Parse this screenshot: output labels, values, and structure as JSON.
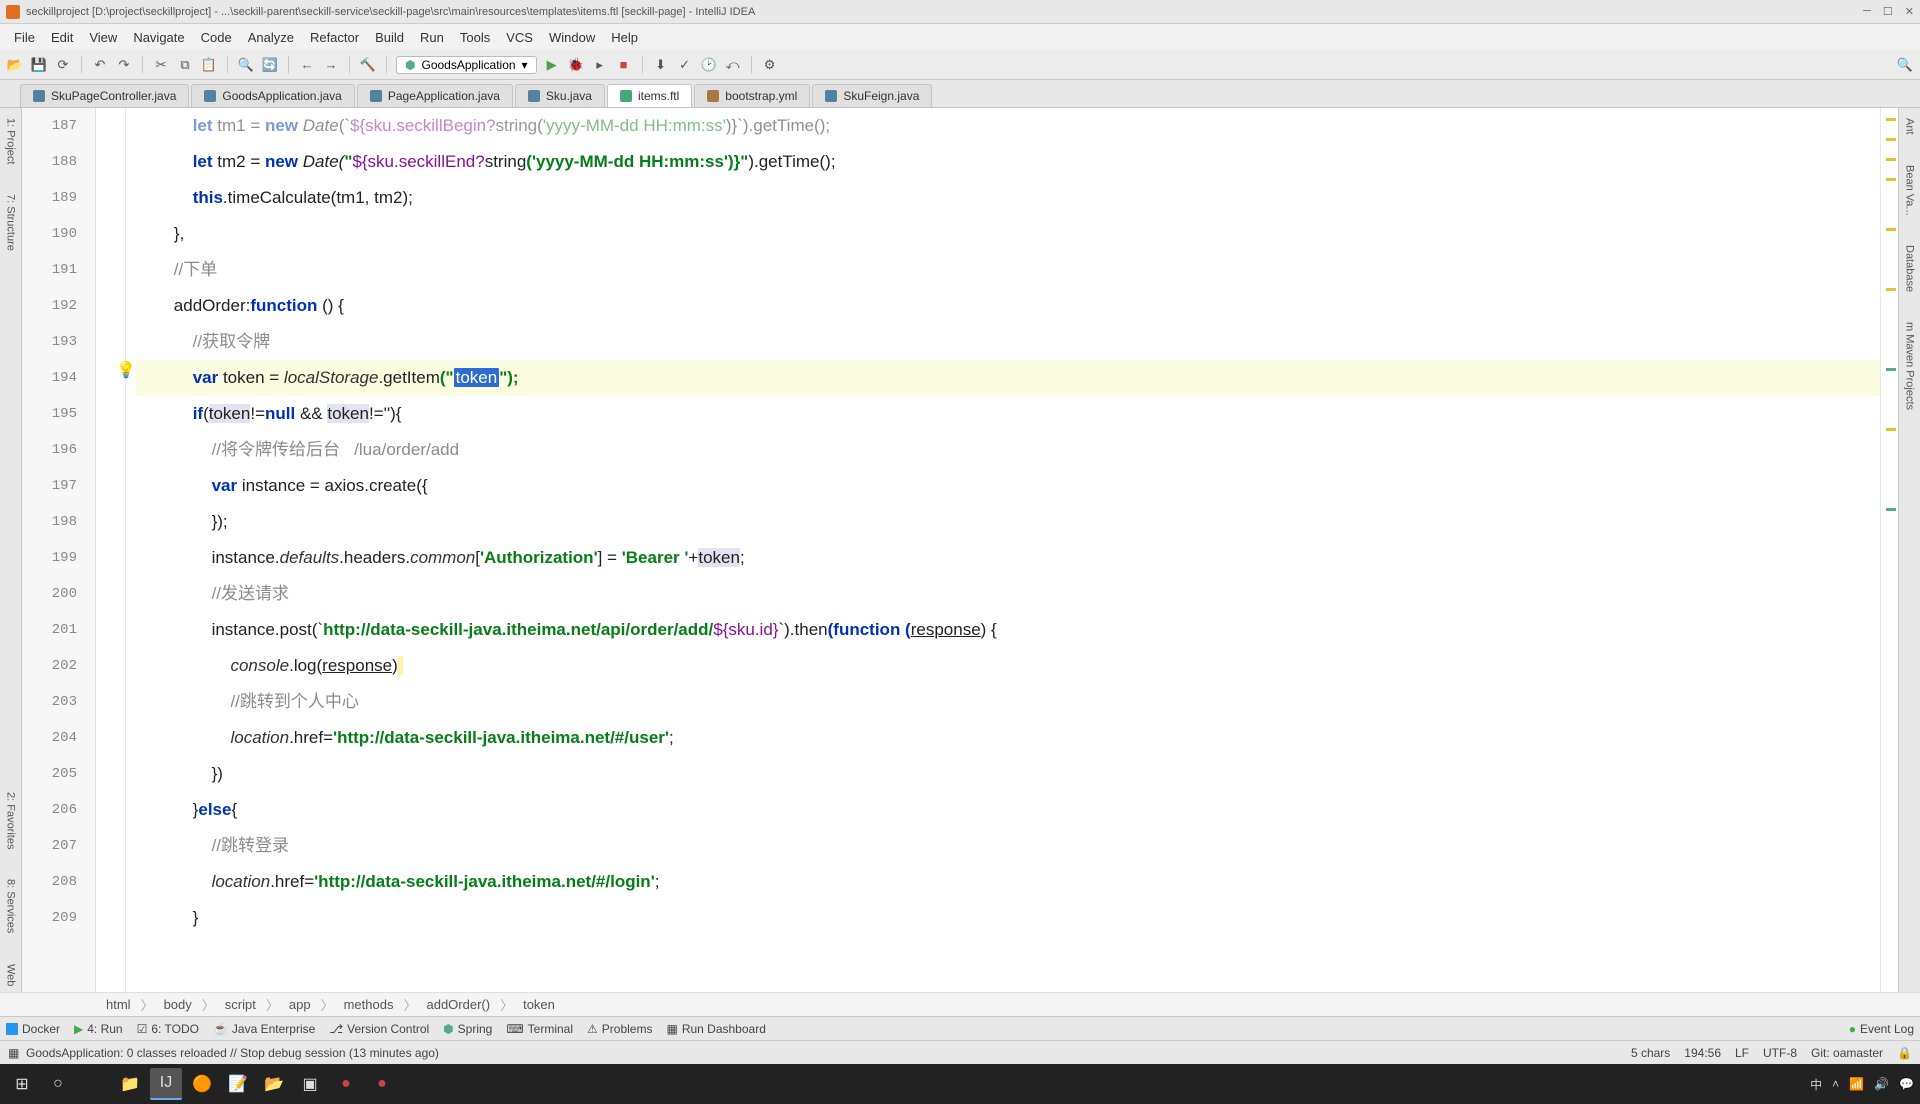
{
  "titlebar": {
    "text": "seckillproject [D:\\project\\seckillproject] - ...\\seckill-parent\\seckill-service\\seckill-page\\src\\main\\resources\\templates\\items.ftl [seckill-page] - IntelliJ IDEA"
  },
  "menu": [
    "File",
    "Edit",
    "View",
    "Navigate",
    "Code",
    "Analyze",
    "Refactor",
    "Build",
    "Run",
    "Tools",
    "VCS",
    "Window",
    "Help"
  ],
  "run_config": {
    "label": "GoodsApplication"
  },
  "tabs": [
    {
      "label": "SkuPageController.java",
      "type": "java",
      "active": false
    },
    {
      "label": "GoodsApplication.java",
      "type": "java",
      "active": false
    },
    {
      "label": "PageApplication.java",
      "type": "java",
      "active": false
    },
    {
      "label": "Sku.java",
      "type": "java",
      "active": false
    },
    {
      "label": "items.ftl",
      "type": "ftl",
      "active": true
    },
    {
      "label": "bootstrap.yml",
      "type": "yml",
      "active": false
    },
    {
      "label": "SkuFeign.java",
      "type": "java",
      "active": false
    }
  ],
  "gutter_start": 187,
  "code": {
    "l187": {
      "pre": "            let tm1 = new Date(`${sku.seckillBegin?string('yyyy-MM-dd HH:mm:ss')}`).getTime();"
    },
    "l188_let": "let",
    "l188_tm2": " tm2 = ",
    "l188_new": "new",
    "l188_date": " Date(",
    "l188_q": "\"",
    "l188_tpl": "${sku.seckillEnd?",
    "l188_str": "string",
    "l188_args": "('yyyy-MM-dd HH:mm:ss')}",
    "l188_q2": "\"",
    "l188_tail": ").getTime();",
    "l189_this": "this",
    "l189_dot": ".",
    "l189_fn": "timeCalculate",
    "l189_p": "(tm1, tm2);",
    "l190": "        },",
    "l191": "        //下单",
    "l192_name": "addOrder",
    "l192_sep": ":",
    "l192_fn": "function",
    "l192_tail": " () {",
    "l193": "            //获取令牌",
    "l194_var": "var",
    "l194_sp": " ",
    "l194_tok": "token",
    "l194_eq": " = ",
    "l194_ls": "localStorage",
    "l194_dot": ".",
    "l194_gi": "getItem",
    "l194_op": "(\"",
    "l194_sel": "token",
    "l194_cl": "\");",
    "l195_if": "if",
    "l195_op": "(",
    "l195_t1": "token",
    "l195_neq": "!=",
    "l195_null": "null",
    "l195_and": " && ",
    "l195_t2": "token",
    "l195_cond": "!=''",
    "l195_tail": "){",
    "l196": "                //将令牌传给后台   /lua/order/add",
    "l197_var": "var",
    "l197_inst": " instance = axios.",
    "l197_create": "create",
    "l197_tail": "({",
    "l198": "                });",
    "l199_pre": "                instance.",
    "l199_def": "defaults",
    "l199_h": ".headers.",
    "l199_com": "common",
    "l199_br": "[",
    "l199_auth": "'Authorization'",
    "l199_eq": "] = ",
    "l199_bearer": "'Bearer '",
    "l199_plus": "+",
    "l199_tok": "token",
    "l199_end": ";",
    "l200": "                //发送请求",
    "l201_pre": "                instance.",
    "l201_post": "post",
    "l201_op": "(`",
    "l201_url": "http://data-seckill-java.itheima.net/api/order/add/",
    "l201_tpl": "${sku.id}",
    "l201_cl": "`).",
    "l201_then": "then",
    "l201_fn": "(function (",
    "l201_resp": "response",
    "l201_tail": ") {",
    "l202_pre": "                    ",
    "l202_con": "console",
    "l202_dot": ".",
    "l202_log": "log",
    "l202_p": "(",
    "l202_resp": "response",
    "l202_cl": ")",
    "l203": "                    //跳转到个人中心",
    "l204_pre": "                    ",
    "l204_loc": "location",
    "l204_href": ".href=",
    "l204_url": "'http://data-seckill-java.itheima.net/#/user'",
    "l204_end": ";",
    "l205": "                })",
    "l206_close": "            }",
    "l206_else": "else",
    "l206_brace": "{",
    "l207": "                //跳转登录",
    "l208_pre": "                ",
    "l208_loc": "location",
    "l208_href": ".href=",
    "l208_url": "'http://data-seckill-java.itheima.net/#/login'",
    "l208_end": ";",
    "l209": "            }"
  },
  "breadcrumb": [
    "html",
    "body",
    "script",
    "app",
    "methods",
    "addOrder()",
    "token"
  ],
  "bottom_panels": {
    "left": [
      "Docker",
      "4: Run",
      "6: TODO",
      "Java Enterprise",
      "Version Control",
      "Spring",
      "Terminal",
      "Problems",
      "Run Dashboard"
    ],
    "right": "Event Log"
  },
  "statusbar": {
    "msg": "GoodsApplication: 0 classes reloaded // Stop debug session (13 minutes ago)",
    "chars": "5 chars",
    "pos": "194:56",
    "eol": "LF",
    "enc": "UTF-8",
    "git": "Git: oamaster",
    "lock": "🔒"
  },
  "left_tools": [
    "1: Project",
    "7: Structure",
    "2: Favorites",
    "8: Services",
    "Web"
  ],
  "right_tools": [
    "Ant",
    "Bean Va...",
    "Database",
    "m Maven Projects"
  ],
  "tray": {
    "ime": "中",
    "time": ""
  }
}
